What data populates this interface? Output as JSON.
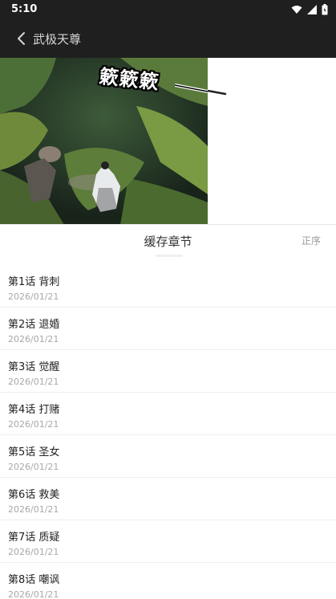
{
  "status": {
    "time": "5:10"
  },
  "header": {
    "title": "武极天尊"
  },
  "video": {
    "overlay_text": "簌簌簌"
  },
  "section": {
    "title": "缓存章节",
    "sort_label": "正序"
  },
  "chapters": [
    {
      "name": "第1话 背刺",
      "date": "2026/01/21"
    },
    {
      "name": "第2话 退婚",
      "date": "2026/01/21"
    },
    {
      "name": "第3话 觉醒",
      "date": "2026/01/21"
    },
    {
      "name": "第4话 打赌",
      "date": "2026/01/21"
    },
    {
      "name": "第5话 圣女",
      "date": "2026/01/21"
    },
    {
      "name": "第6话 救美",
      "date": "2026/01/21"
    },
    {
      "name": "第7话 质疑",
      "date": "2026/01/21"
    },
    {
      "name": "第8话 嘲讽",
      "date": "2026/01/21"
    }
  ],
  "icons": {
    "back": "chevron-left-icon",
    "wifi": "wifi-icon",
    "signal": "signal-icon",
    "battery": "battery-icon"
  },
  "colors": {
    "app_bar": "#1f1f1f",
    "background": "#ffffff"
  }
}
